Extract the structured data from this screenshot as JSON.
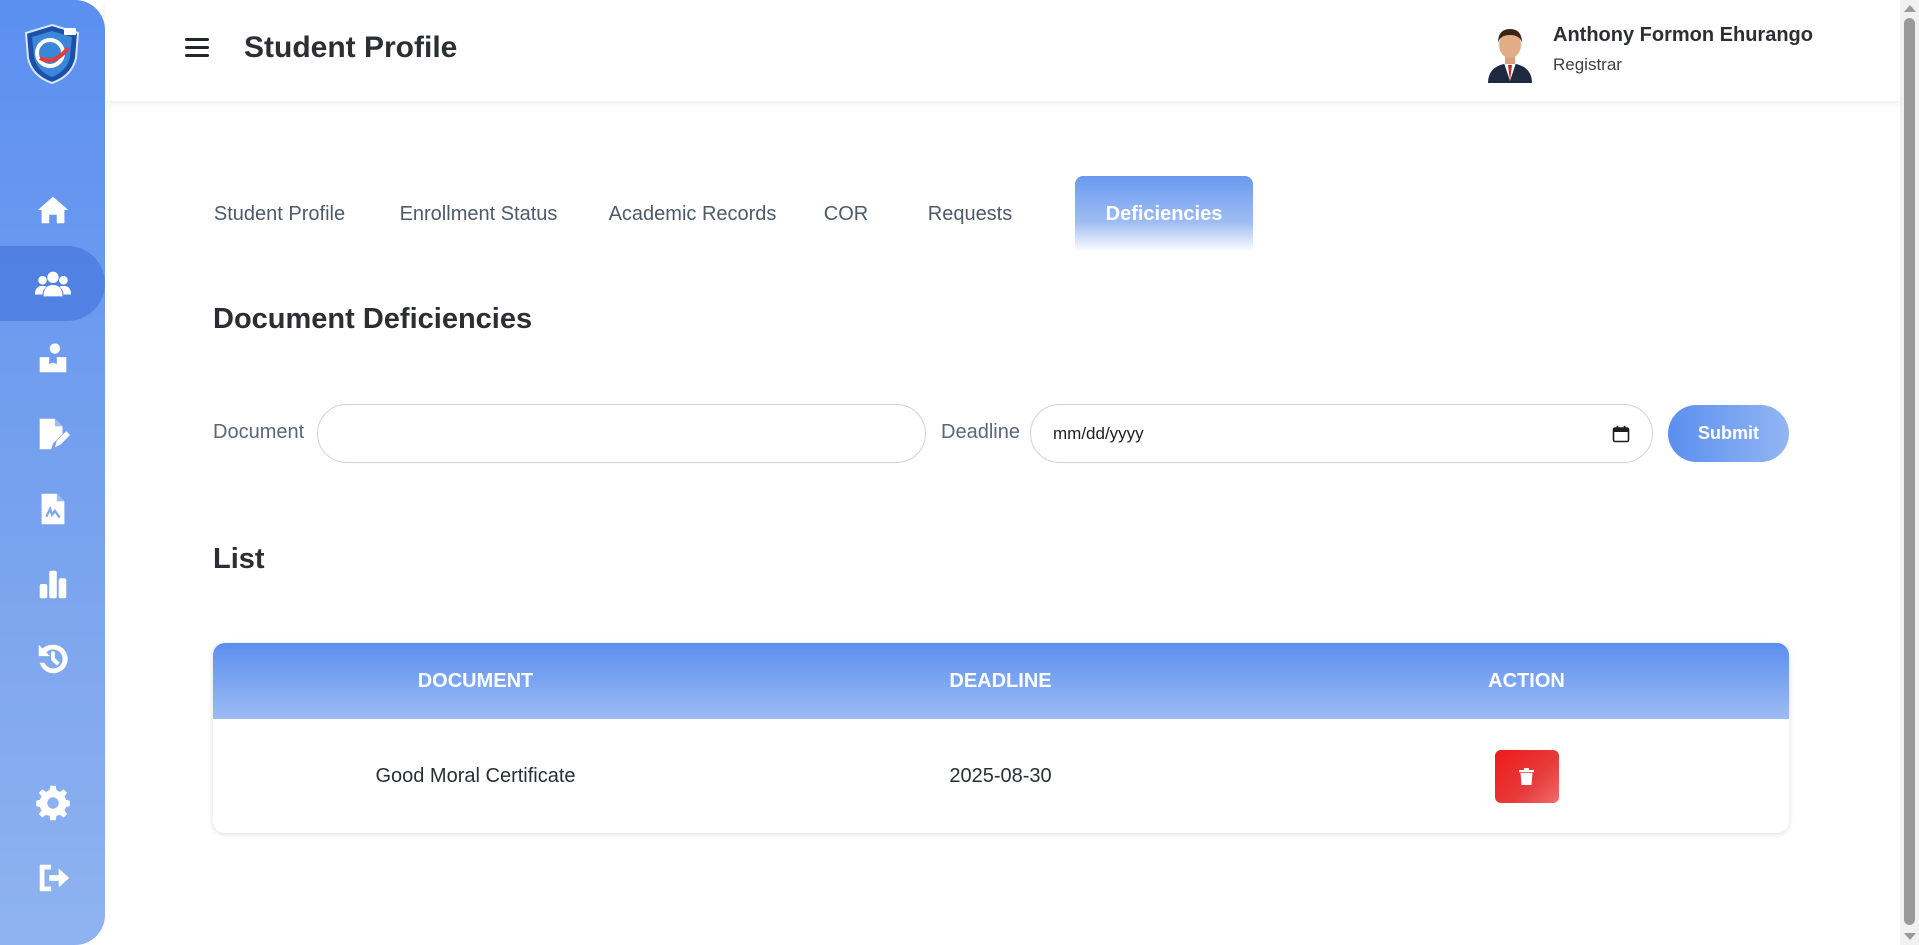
{
  "header": {
    "title": "Student Profile",
    "user_name": "Anthony Formon Ehurango",
    "user_role": "Registrar"
  },
  "sidebar": {
    "items": [
      {
        "name": "home",
        "icon": "home-icon"
      },
      {
        "name": "students",
        "icon": "users-icon",
        "active": true
      },
      {
        "name": "enrollment",
        "icon": "reader-icon"
      },
      {
        "name": "records",
        "icon": "file-edit-icon"
      },
      {
        "name": "documents",
        "icon": "file-signature-icon"
      },
      {
        "name": "reports",
        "icon": "bar-chart-icon"
      },
      {
        "name": "history",
        "icon": "history-icon"
      },
      {
        "name": "settings",
        "icon": "gear-icon"
      },
      {
        "name": "logout",
        "icon": "logout-icon"
      }
    ]
  },
  "tabs": [
    {
      "label": "Student Profile"
    },
    {
      "label": "Enrollment Status"
    },
    {
      "label": "Academic Records"
    },
    {
      "label": "COR"
    },
    {
      "label": "Requests"
    },
    {
      "label": "Deficiencies",
      "active": true
    }
  ],
  "main": {
    "section_title": "Document Deficiencies",
    "form": {
      "document_label": "Document",
      "document_value": "",
      "deadline_label": "Deadline",
      "deadline_placeholder": "mm/dd/yyyy",
      "submit_label": "Submit"
    },
    "list_title": "List",
    "table": {
      "headers": [
        "DOCUMENT",
        "DEADLINE",
        "ACTION"
      ],
      "rows": [
        {
          "document": "Good Moral Certificate",
          "deadline": "2025-08-30",
          "action_icon": "trash-icon"
        }
      ]
    }
  },
  "colors": {
    "accent": "#5b8ff0",
    "danger": "#f01919"
  }
}
